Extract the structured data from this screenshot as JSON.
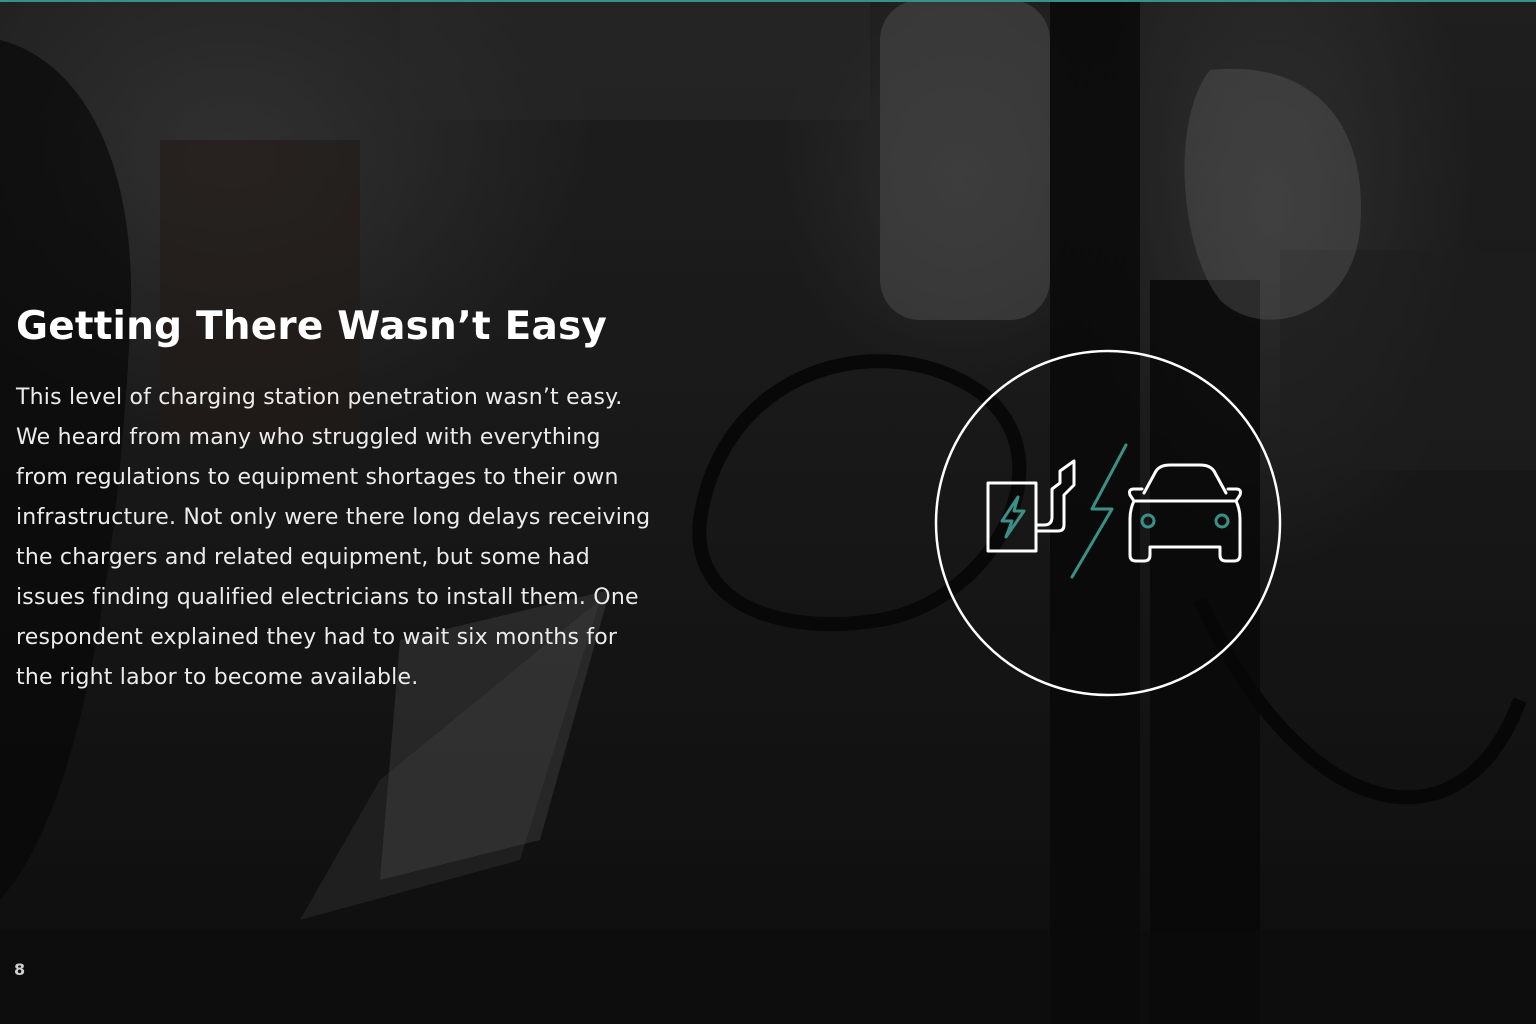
{
  "page": {
    "title": "Getting There Wasn’t Easy",
    "body": "This level of charging station penetration wasn’t easy. We heard from many who struggled with everything from regulations to equipment shortages to their own infrastructure. Not only were there long delays receiving the chargers and related equipment, but some had issues finding qualified electricians to install them. One respondent explained they had to wait six months for the right labor to become available.",
    "page_number": "8"
  },
  "badge": {
    "icons": [
      "charging-station-icon",
      "lightning-bolt-icon",
      "electric-car-icon"
    ]
  },
  "colors": {
    "accent": "#3a8f86",
    "text": "#ffffff",
    "background": "#1c1c1c"
  }
}
